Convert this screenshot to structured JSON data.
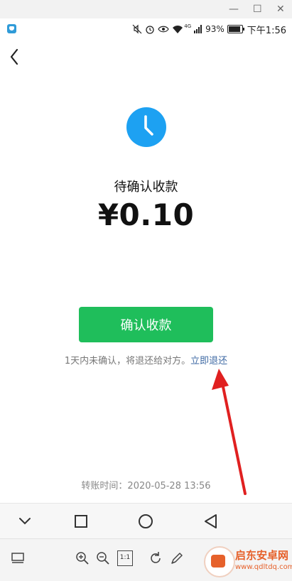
{
  "window": {
    "minimize_icon": "minimize-icon",
    "maximize_icon": "maximize-icon",
    "close_icon": "close-icon"
  },
  "status_bar": {
    "battery_percent": "93%",
    "time": "下午1:56",
    "network_type": "4G",
    "icons": [
      "mute-icon",
      "alarm-icon",
      "eye-icon",
      "wifi-icon",
      "signal-icon",
      "battery-icon"
    ]
  },
  "header": {
    "back_icon": "chevron-left-icon"
  },
  "main": {
    "status_icon": "clock-icon",
    "status_text": "待确认收款",
    "amount": "¥0.10",
    "confirm_button": "确认收款",
    "notice_text": "1天内未确认，将退还给对方。",
    "refund_link": "立即退还",
    "transfer_time": "转账时间：2020-05-28 13:56"
  },
  "nav_bar": {
    "items": [
      "chevron-down-icon",
      "square-icon",
      "circle-icon",
      "triangle-back-icon"
    ]
  },
  "toolbar": {
    "items": [
      "layout-icon",
      "zoom-in-icon",
      "zoom-out-icon",
      "actual-size-icon",
      "rotate-icon",
      "pen-icon"
    ],
    "actual_size_label": "1:1"
  },
  "watermark": {
    "title": "启东安卓网",
    "url": "www.qdltdq.com"
  },
  "colors": {
    "accent_green": "#1fbe5b",
    "link_blue": "#3f6aa4",
    "clock_blue": "#1da1f2",
    "arrow_red": "#e02020"
  }
}
